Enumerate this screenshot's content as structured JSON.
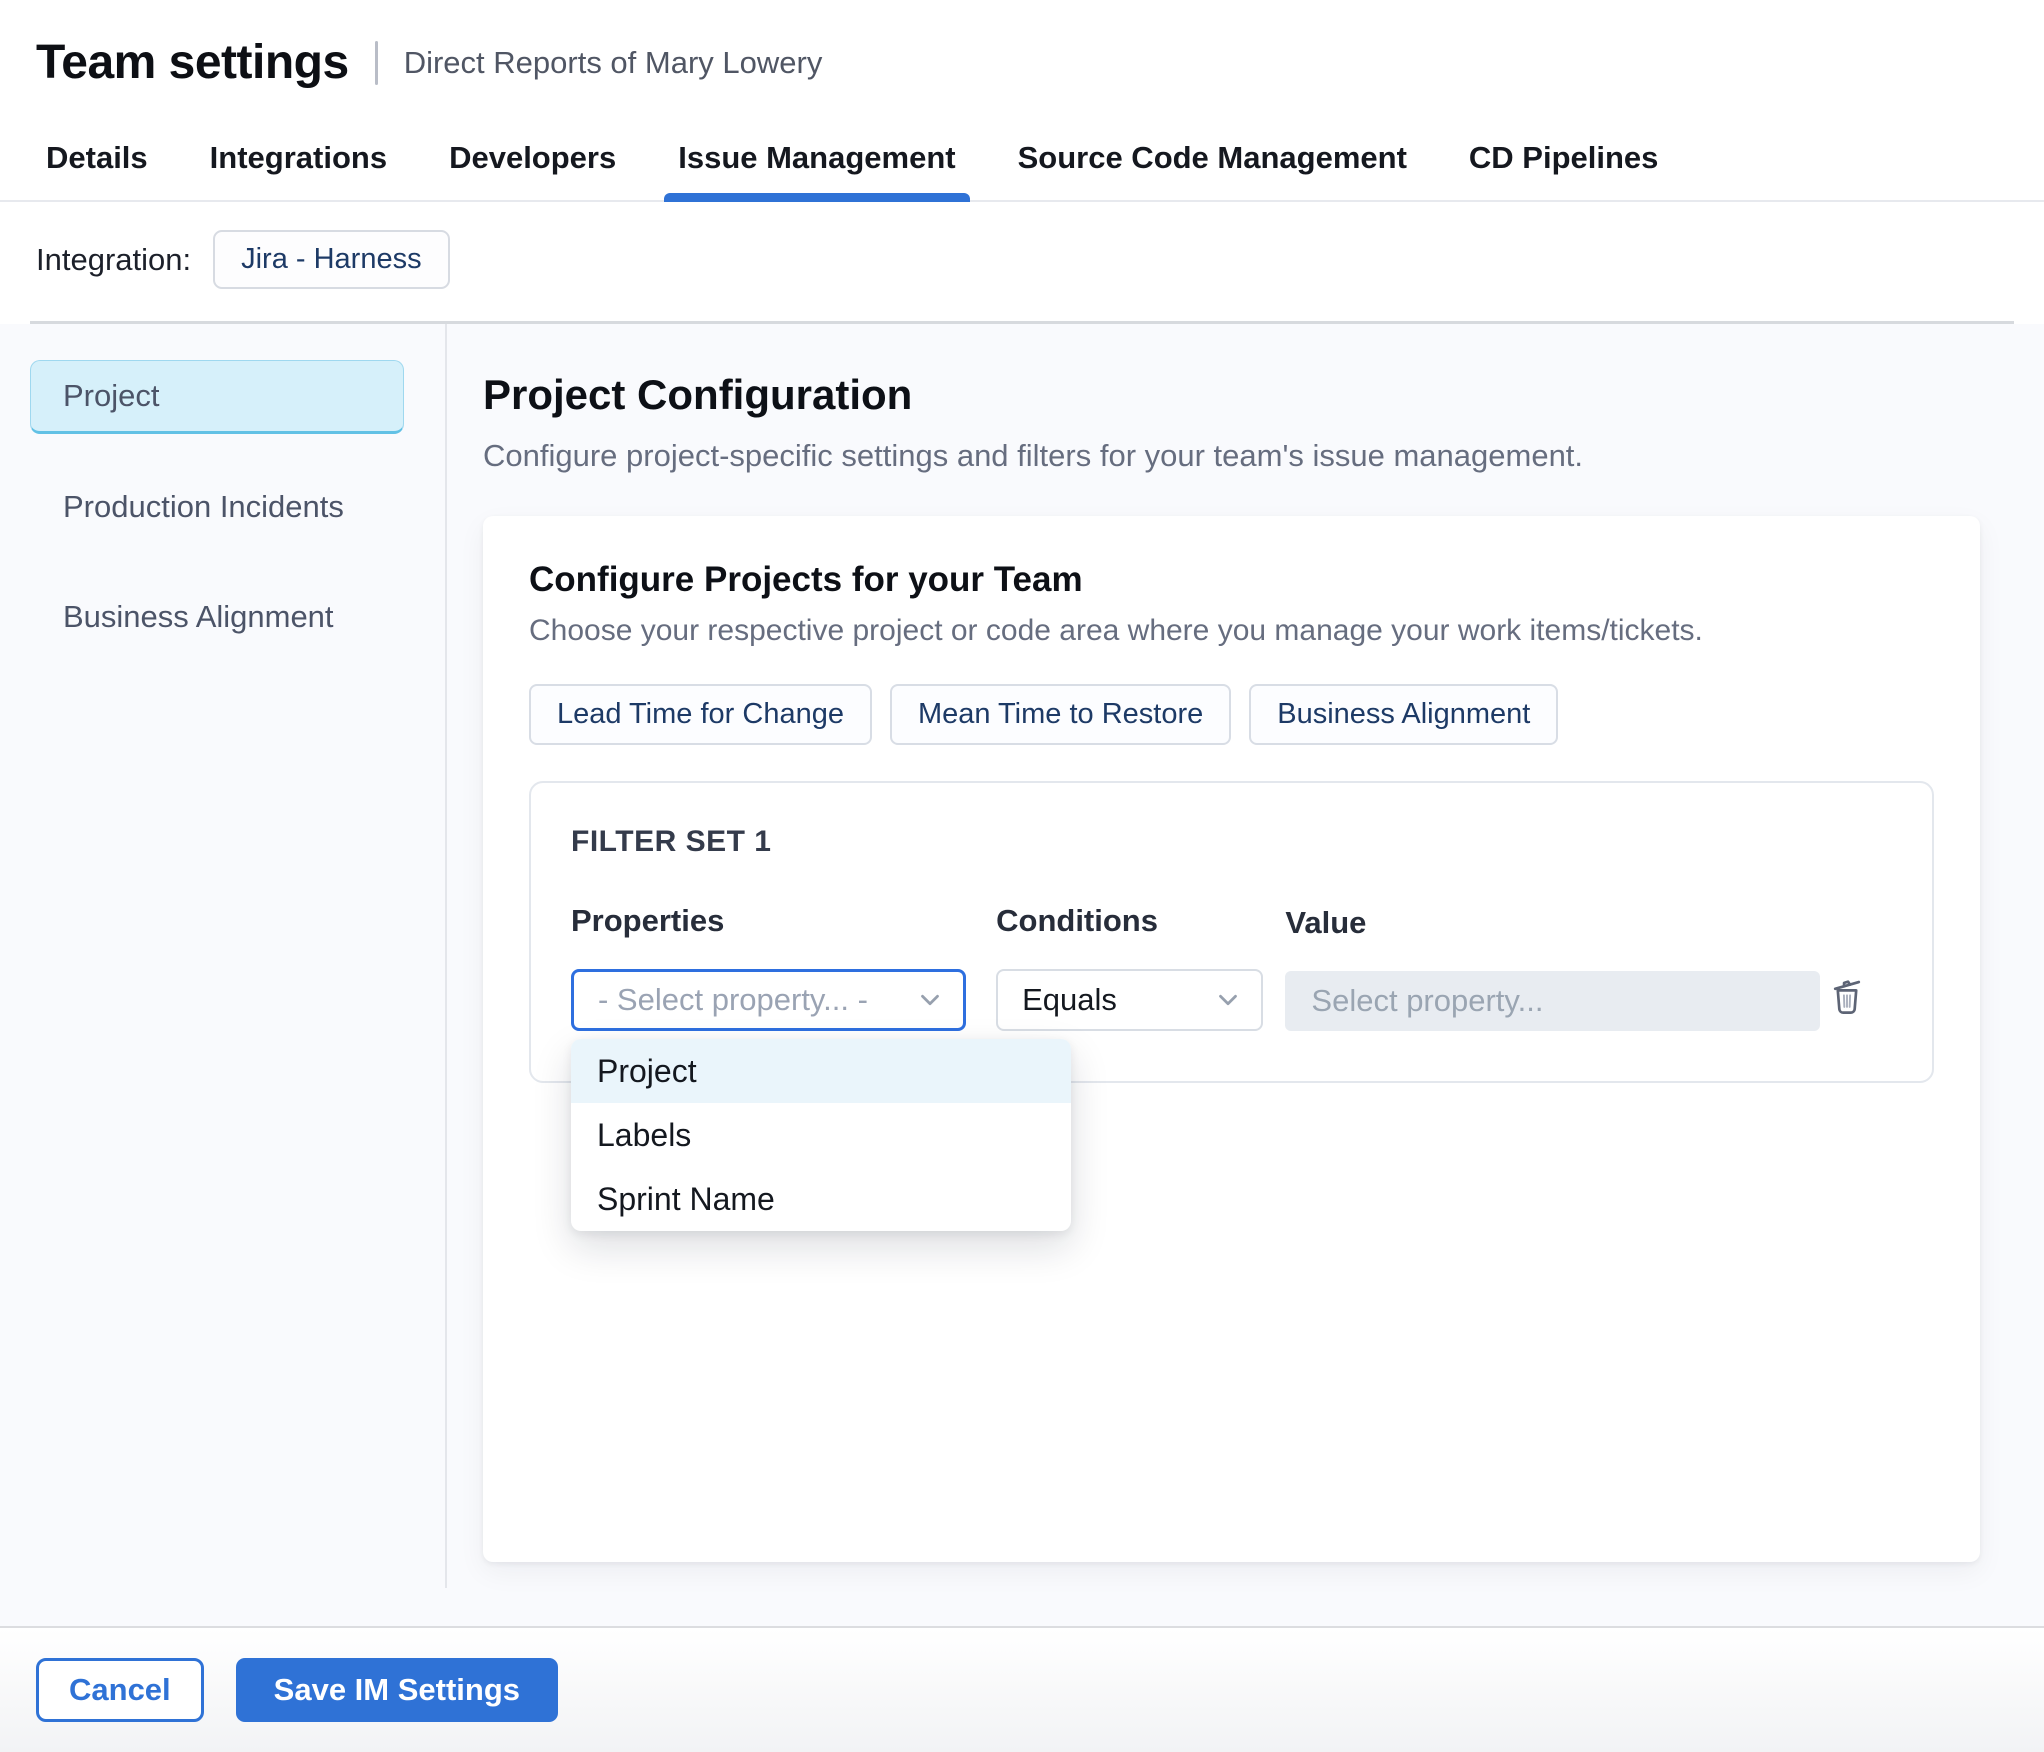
{
  "header": {
    "title": "Team settings",
    "subtitle": "Direct Reports of Mary Lowery"
  },
  "tabs": [
    {
      "label": "Details",
      "active": false
    },
    {
      "label": "Integrations",
      "active": false
    },
    {
      "label": "Developers",
      "active": false
    },
    {
      "label": "Issue Management",
      "active": true
    },
    {
      "label": "Source Code Management",
      "active": false
    },
    {
      "label": "CD Pipelines",
      "active": false
    }
  ],
  "integration": {
    "label": "Integration:",
    "value": "Jira - Harness"
  },
  "sidebar": {
    "items": [
      {
        "label": "Project",
        "selected": true
      },
      {
        "label": "Production Incidents",
        "selected": false
      },
      {
        "label": "Business Alignment",
        "selected": false
      }
    ]
  },
  "main": {
    "title": "Project Configuration",
    "subtitle": "Configure project-specific settings and filters for your team's issue management.",
    "card": {
      "title": "Configure Projects for your Team",
      "subtitle": "Choose your respective project or code area where you manage your work items/tickets.",
      "chips": [
        {
          "label": "Lead Time for Change"
        },
        {
          "label": "Mean Time to Restore"
        },
        {
          "label": "Business Alignment"
        }
      ],
      "filter_set": {
        "title": "FILTER SET 1",
        "columns": {
          "properties": "Properties",
          "conditions": "Conditions",
          "value": "Value"
        },
        "property_select": {
          "value": "- Select property... -"
        },
        "condition_select": {
          "value": "Equals"
        },
        "value_input": {
          "placeholder": "Select property..."
        },
        "dropdown": {
          "options": [
            {
              "label": "Project",
              "highlighted": true
            },
            {
              "label": "Labels",
              "highlighted": false
            },
            {
              "label": "Sprint Name",
              "highlighted": false
            }
          ]
        }
      }
    }
  },
  "footer": {
    "cancel_label": "Cancel",
    "save_label": "Save IM Settings"
  },
  "colors": {
    "primary_blue": "#2f72d6",
    "focus_border_blue": "#2e6fdf",
    "navy_chip_text": "#1d3a66",
    "selected_sidebar_bg": "#d6f0fa",
    "selected_sidebar_border": "#62c1e5",
    "dropdown_highlight": "#eaf5fb",
    "disabled_input_bg": "#e8ecf1",
    "page_background": "#f9fafd"
  }
}
